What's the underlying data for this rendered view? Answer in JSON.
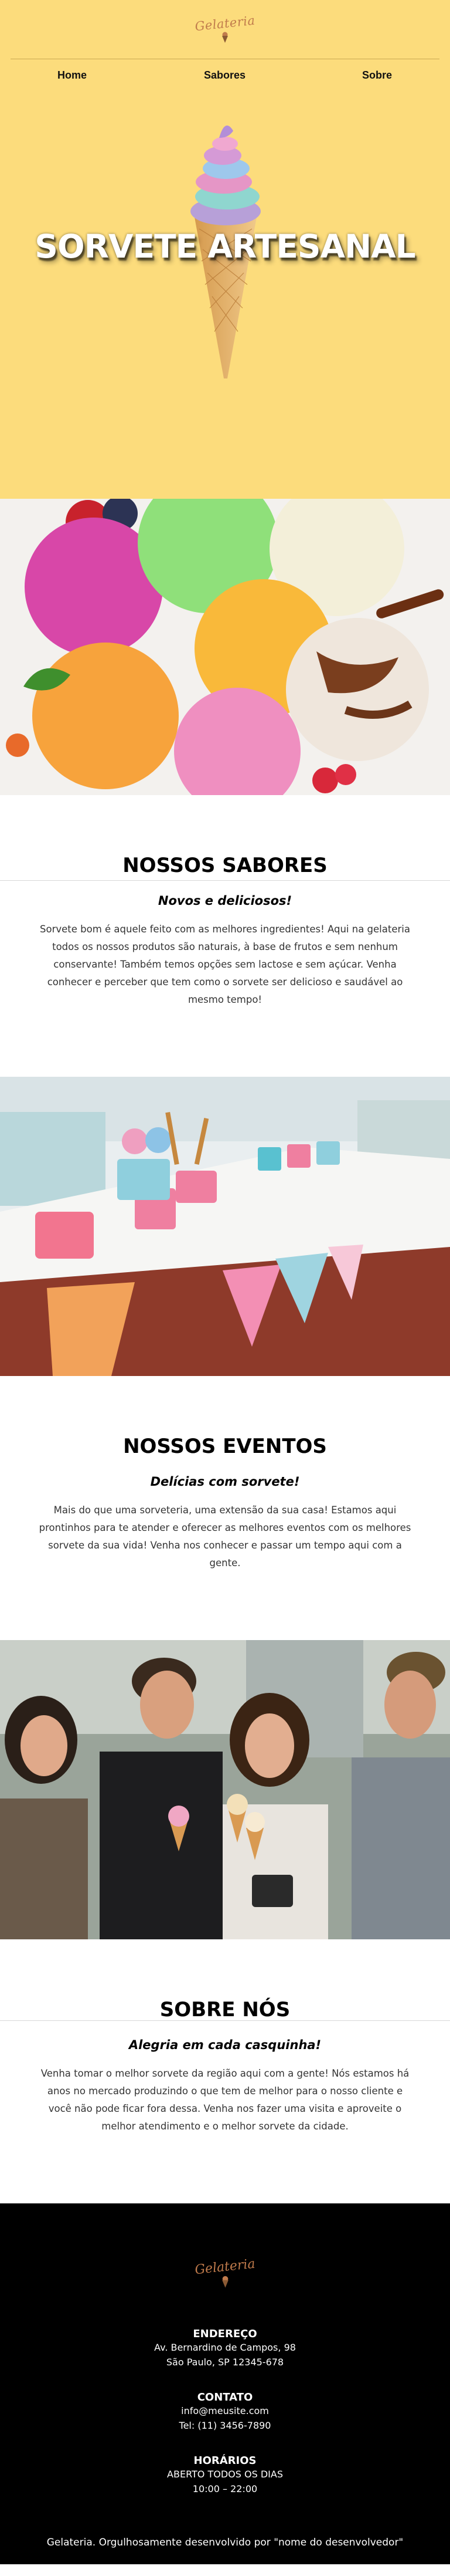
{
  "brand": {
    "logo_text": "Gelateria",
    "accent": "#c07b4c",
    "hero_bg": "#fcdc7c"
  },
  "nav": {
    "items": [
      {
        "label": "Home"
      },
      {
        "label": "Sabores"
      },
      {
        "label": "Sobre"
      }
    ]
  },
  "hero": {
    "title": "SORVETE ARTESANAL"
  },
  "sabores": {
    "title": "NOSSOS SABORES",
    "subtitle": "Novos e deliciosos!",
    "body": "Sorvete bom é aquele feito com as melhores ingredientes! Aqui na gelateria todos os nossos produtos são naturais, à base de frutos e sem nenhum conservante! Também temos opções sem lactose e sem açúcar. Venha conhecer e perceber que tem como o sorvete ser delicioso e saudável ao mesmo tempo!"
  },
  "eventos": {
    "title": "NOSSOS EVENTOS",
    "subtitle": "Delícias com sorvete!",
    "body": "Mais do que uma sorveteria, uma extensão da sua casa! Estamos aqui prontinhos para te atender e oferecer as melhores eventos com os melhores sorvete da sua vida! Venha nos conhecer e passar um tempo aqui com a gente."
  },
  "sobre": {
    "title": "SOBRE NÓS",
    "subtitle": "Alegria em cada casquinha!",
    "body": "Venha tomar o melhor sorvete da região aqui com a gente! Nós estamos há anos no mercado produzindo o que tem de melhor para o nosso cliente e você não pode ficar fora dessa. Venha nos fazer uma visita e aproveite o melhor atendimento e o melhor sorvete da cidade."
  },
  "footer": {
    "endereco_title": "ENDEREÇO",
    "endereco_line1": "Av. Bernardino de Campos, 98",
    "endereco_line2": "São Paulo, SP 12345-678",
    "contato_title": "CONTATO",
    "contato_email": "info@meusite.com",
    "contato_tel": "Tel: (11) 3456-7890",
    "horarios_title": "HORÁRIOS",
    "horarios_line1": "ABERTO TODOS OS DIAS",
    "horarios_line2": "10:00 – 22:00",
    "copyright": "Gelateria. Orgulhosamente desenvolvido por \"nome do desenvolvedor\""
  }
}
